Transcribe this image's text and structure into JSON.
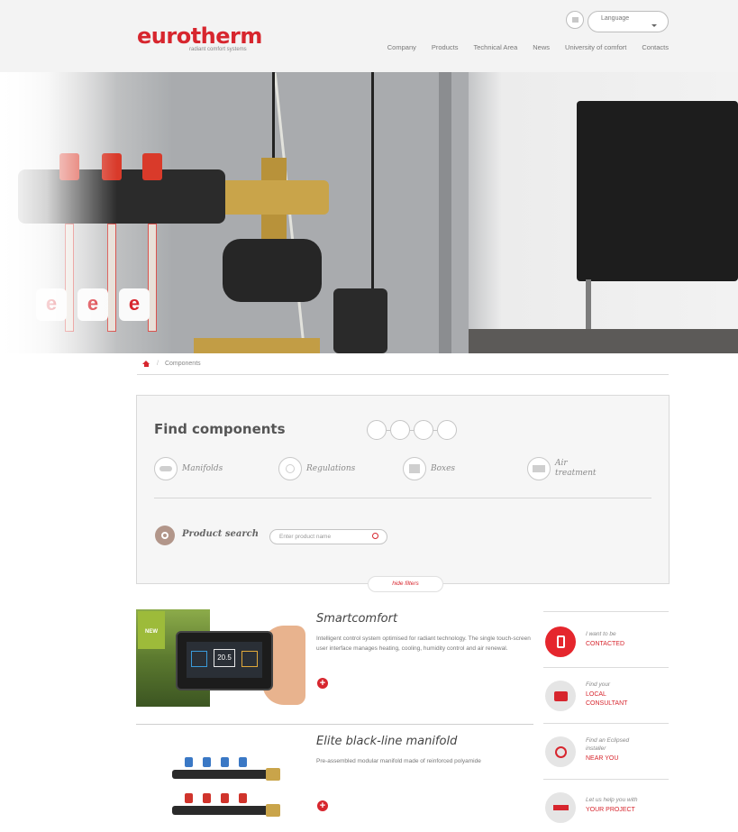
{
  "header": {
    "logo": "eurotherm",
    "tagline": "radiant comfort systems",
    "language_placeholder": "Language",
    "nav": [
      "Company",
      "Products",
      "Technical Area",
      "News",
      "University of comfort",
      "Contacts"
    ]
  },
  "breadcrumb": {
    "current": "Components"
  },
  "filters": {
    "title": "Find components",
    "categories": [
      "Manifolds",
      "Regulations",
      "Boxes",
      "Air treatment"
    ],
    "product_search_label": "Product search",
    "search_placeholder": "Enter product name",
    "hide_filters": "hide filters"
  },
  "products": [
    {
      "badge": "NEW",
      "title": "Smartcomfort",
      "description": "Intelligent control system optimised for radiant technology. The single touch-screen user interface manages heating, cooling, humidity control and air renewal.",
      "screen_value": "20.5"
    },
    {
      "title": "Elite black-line manifold",
      "description": "Pre-assembled modular manifold made of reinforced polyamide"
    }
  ],
  "side": [
    {
      "small": "I want to be",
      "big": "CONTACTED",
      "icon": "phone-icon",
      "color": "#e5262d"
    },
    {
      "small": "Find your",
      "big": "LOCAL CONSULTANT",
      "icon": "briefcase-icon",
      "color": "#e5e5e5"
    },
    {
      "small": "Find an Eclipsed installer",
      "big": "NEAR YOU",
      "icon": "installer-icon",
      "color": "#e5e5e5"
    },
    {
      "small": "Let us help you with",
      "big": "YOUR PROJECT",
      "icon": "ruler-icon",
      "color": "#e5e5e5"
    }
  ],
  "colors": {
    "brand": "#d7262e",
    "header_bg": "#f3f3f3"
  }
}
